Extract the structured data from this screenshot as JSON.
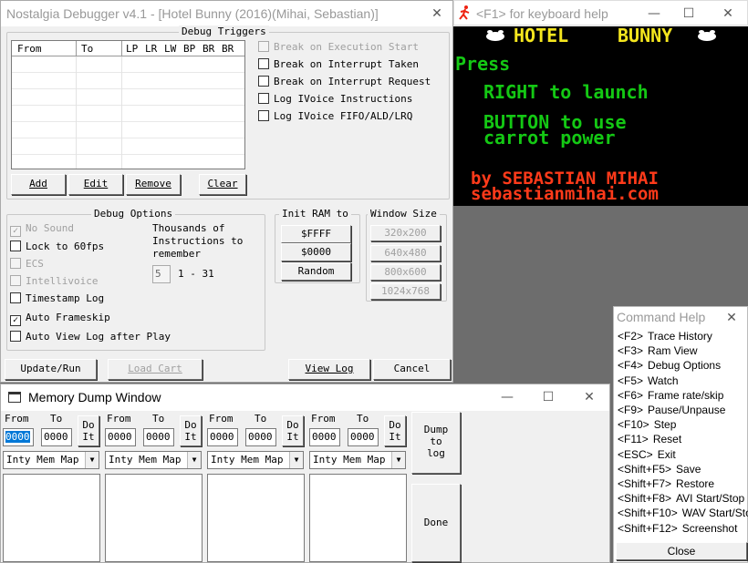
{
  "debugger": {
    "title": "Nostalgia Debugger v4.1 - [Hotel Bunny (2016)(Mihai, Sebastian)]",
    "triggers_group": "Debug Triggers",
    "table_headers": [
      "From",
      "To",
      "LP",
      "LR",
      "LW",
      "BP",
      "BR",
      "BR"
    ],
    "triggers": [
      {
        "label": "Break on Execution Start",
        "checked": false,
        "disabled": true
      },
      {
        "label": "Break on Interrupt Taken",
        "checked": false,
        "disabled": false
      },
      {
        "label": "Break on Interrupt Request",
        "checked": false,
        "disabled": false
      },
      {
        "label": "Log IVoice Instructions",
        "checked": false,
        "disabled": false
      },
      {
        "label": "Log IVoice FIFO/ALD/LRQ",
        "checked": false,
        "disabled": false
      }
    ],
    "buttons": {
      "add": "Add",
      "edit": "Edit",
      "remove": "Remove",
      "clear": "Clear"
    },
    "options_group": "Debug Options",
    "options": [
      {
        "label": "No Sound",
        "checked": true,
        "disabled": true
      },
      {
        "label": "Lock to 60fps",
        "checked": false,
        "disabled": false
      },
      {
        "label": "ECS",
        "checked": false,
        "disabled": true
      },
      {
        "label": "Intellivoice",
        "checked": false,
        "disabled": true
      },
      {
        "label": "Timestamp Log",
        "checked": false,
        "disabled": false
      },
      {
        "label": "Auto Frameskip",
        "checked": true,
        "disabled": false
      },
      {
        "label": "Auto View Log after Play",
        "checked": false,
        "disabled": false
      }
    ],
    "thousands_line1": "Thousands of",
    "thousands_line2": "Instructions to",
    "thousands_line3": "remember",
    "thousands_value": "5",
    "thousands_range": "1 - 31",
    "init_ram_group": "Init RAM to",
    "init_ram_buttons": [
      "$FFFF",
      "$0000",
      "Random"
    ],
    "window_size_group": "Window Size",
    "window_sizes": [
      "320x200",
      "640x480",
      "800x600",
      "1024x768"
    ],
    "bottom_buttons": {
      "update": "Update/Run",
      "load_cart": "Load Cart",
      "view_log": "View Log",
      "cancel": "Cancel"
    }
  },
  "game": {
    "title": "<F1> for keyboard help",
    "title_left": "HOTEL",
    "title_right": "BUNNY",
    "press": "Press",
    "line1": "RIGHT to launch",
    "line2": "BUTTON to use",
    "line3": "carrot power",
    "credit": "by SEBASTIAN MIHAI",
    "site": "sebastianmihai.com",
    "colors": {
      "bg": "#000000",
      "title": "#f5e61e",
      "green": "#14c814",
      "red": "#ff3a1a",
      "white": "#ffffff"
    }
  },
  "command_help": {
    "title": "Command Help",
    "items": [
      {
        "key": "<F2>",
        "action": "Trace History"
      },
      {
        "key": "<F3>",
        "action": "Ram View"
      },
      {
        "key": "<F4>",
        "action": "Debug Options"
      },
      {
        "key": "<F5>",
        "action": "Watch"
      },
      {
        "key": "<F6>",
        "action": "Frame rate/skip"
      },
      {
        "key": "<F9>",
        "action": "Pause/Unpause"
      },
      {
        "key": "<F10>",
        "action": "Step"
      },
      {
        "key": "<F11>",
        "action": "Reset"
      },
      {
        "key": "<ESC>",
        "action": "Exit"
      },
      {
        "key": "<Shift+F5>",
        "action": "Save"
      },
      {
        "key": "<Shift+F7>",
        "action": "Restore"
      },
      {
        "key": "<Shift+F8>",
        "action": "AVI Start/Stop"
      },
      {
        "key": "<Shift+F10>",
        "action": "WAV Start/Stop"
      },
      {
        "key": "<Shift+F12>",
        "action": "Screenshot"
      }
    ],
    "close": "Close"
  },
  "memory_dump": {
    "title": "Memory Dump Window",
    "from_label": "From",
    "to_label": "To",
    "do_it_line1": "Do",
    "do_it_line2": "It",
    "panels": [
      {
        "from": "0000",
        "to": "0000",
        "mode": "Inty Mem Map"
      },
      {
        "from": "0000",
        "to": "0000",
        "mode": "Inty Mem Map"
      },
      {
        "from": "0000",
        "to": "0000",
        "mode": "Inty Mem Map"
      },
      {
        "from": "0000",
        "to": "0000",
        "mode": "Inty Mem Map"
      }
    ],
    "dump_line1": "Dump",
    "dump_line2": "to",
    "dump_line3": "log",
    "done": "Done"
  }
}
